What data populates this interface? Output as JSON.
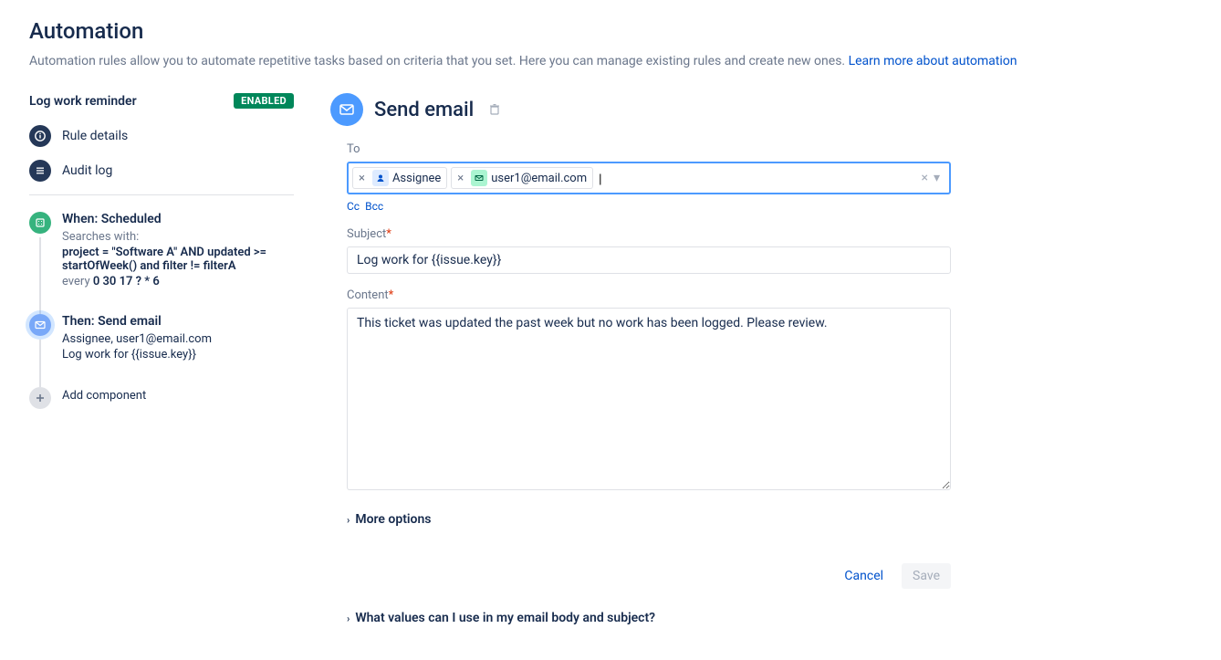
{
  "header": {
    "title": "Automation",
    "subtitle": "Automation rules allow you to automate repetitive tasks based on criteria that you set. Here you can manage existing rules and create new ones. ",
    "learn_more": "Learn more about automation"
  },
  "rule": {
    "name": "Log work reminder",
    "status": "ENABLED"
  },
  "nav": {
    "details": "Rule details",
    "audit": "Audit log"
  },
  "steps": {
    "when": {
      "title": "When: Scheduled",
      "subtitle": "Searches with:",
      "jql": "project = \"Software A\" AND updated >= startOfWeek() and filter != filterA",
      "cron_prefix": "every ",
      "cron": "0 30 17 ? * 6"
    },
    "then": {
      "title": "Then: Send email",
      "recipients": "Assignee, user1@email.com",
      "subject_preview": "Log work for {{issue.key}}"
    },
    "add": "Add component"
  },
  "panel": {
    "title": "Send email",
    "to_label": "To",
    "chips": [
      "Assignee",
      "user1@email.com"
    ],
    "cc": "Cc",
    "bcc": "Bcc",
    "subject_label": "Subject",
    "subject_value": "Log work for {{issue.key}}",
    "content_label": "Content",
    "content_value": "This ticket was updated the past week but no work has been logged. Please review.",
    "more_options": "More options",
    "help": "What values can I use in my email body and subject?"
  },
  "footer": {
    "cancel": "Cancel",
    "save": "Save"
  }
}
